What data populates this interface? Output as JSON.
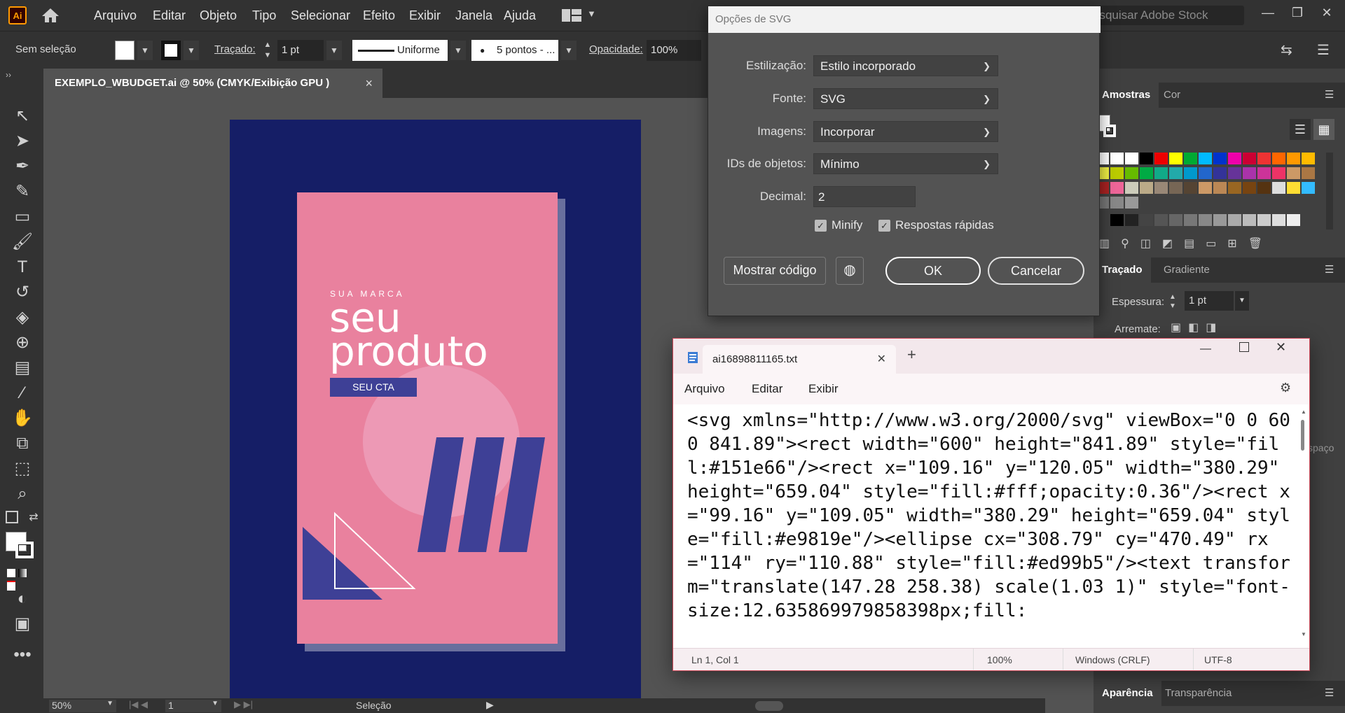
{
  "app": {
    "logo": "Ai",
    "menu": [
      "Arquivo",
      "Editar",
      "Objeto",
      "Tipo",
      "Selecionar",
      "Efeito",
      "Exibir",
      "Janela",
      "Ajuda"
    ],
    "stock_search_placeholder": "esquisar Adobe Stock"
  },
  "control_bar": {
    "selection": "Sem seleção",
    "stroke_label": "Traçado:",
    "stroke_weight": "1 pt",
    "stroke_profile": "Uniforme",
    "brush": "5 pontos - ...",
    "opacity_label": "Opacidade:",
    "opacity_value": "100%"
  },
  "document_tab": {
    "title": "EXEMPLO_WBUDGET.ai @ 50% (CMYK/Exibição GPU )",
    "close": "×"
  },
  "artboard": {
    "brand": "SUA MARCA",
    "headline_1": "seu",
    "headline_2": "produto",
    "cta": "SEU CTA",
    "colors": {
      "background": "#151e66",
      "card": "#e9819e",
      "circle": "#ed99b5",
      "accent": "#3e4096"
    }
  },
  "status_bar": {
    "zoom": "50%",
    "page": "1",
    "tool": "Seleção"
  },
  "panels": {
    "swatches_tabs": [
      "Amostras",
      "Cor"
    ],
    "stroke_tabs": [
      "Traçado",
      "Gradiente"
    ],
    "stroke_weight_label": "Espessura:",
    "stroke_weight_value": "1 pt",
    "cap_label": "Arremate:",
    "bottom_tabs": [
      "Aparência",
      "Transparência"
    ],
    "partial_label": "spaço"
  },
  "svg_dialog": {
    "title": "Opções de SVG",
    "styling_label": "Estilização:",
    "styling_value": "Estilo incorporado",
    "font_label": "Fonte:",
    "font_value": "SVG",
    "images_label": "Imagens:",
    "images_value": "Incorporar",
    "ids_label": "IDs de objetos:",
    "ids_value": "Mínimo",
    "decimal_label": "Decimal:",
    "decimal_value": "2",
    "minify_label": "Minify",
    "responsive_label": "Respostas rápidas",
    "show_code": "Mostrar código",
    "ok": "OK",
    "cancel": "Cancelar"
  },
  "notepad": {
    "tab_title": "ai16898811165.txt",
    "menu": [
      "Arquivo",
      "Editar",
      "Exibir"
    ],
    "content": "<svg xmlns=\"http://www.w3.org/2000/svg\" viewBox=\"0 0 600 841.89\"><rect width=\"600\" height=\"841.89\" style=\"fill:#151e66\"/><rect x=\"109.16\" y=\"120.05\" width=\"380.29\" height=\"659.04\" style=\"fill:#fff;opacity:0.36\"/><rect x=\"99.16\" y=\"109.05\" width=\"380.29\" height=\"659.04\" style=\"fill:#e9819e\"/><ellipse cx=\"308.79\" cy=\"470.49\" rx=\"114\" ry=\"110.88\" style=\"fill:#ed99b5\"/><text transform=\"translate(147.28 258.38) scale(1.03 1)\" style=\"font-size:12.635869979858398px;fill:",
    "status_position": "Ln 1, Col 1",
    "status_zoom": "100%",
    "status_eol": "Windows (CRLF)",
    "status_encoding": "UTF-8"
  }
}
